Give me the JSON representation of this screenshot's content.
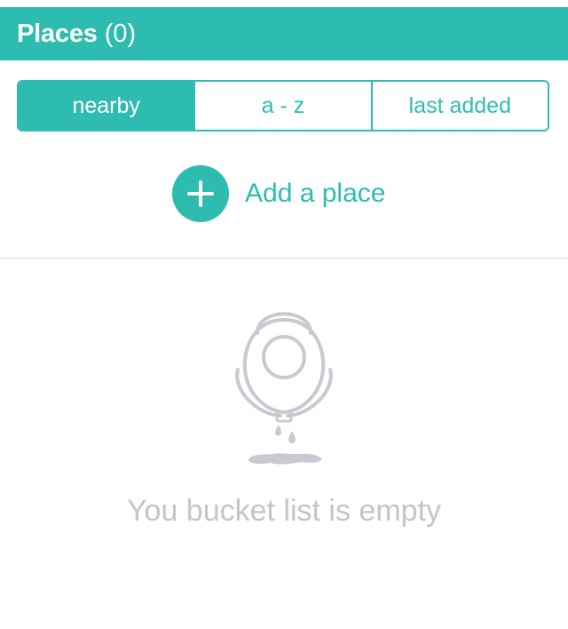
{
  "header": {
    "title": "Places",
    "count": "(0)"
  },
  "sort_tabs": [
    {
      "label": "nearby",
      "active": true
    },
    {
      "label": "a - z",
      "active": false
    },
    {
      "label": "last added",
      "active": false
    }
  ],
  "add_place": {
    "label": "Add a place",
    "icon": "plus-icon"
  },
  "empty_state": {
    "icon": "leaking-bucket-icon",
    "message": "You bucket list is empty"
  },
  "colors": {
    "accent": "#2fbcb0",
    "muted": "#c4c4cc",
    "divider": "#d8d8d8"
  }
}
